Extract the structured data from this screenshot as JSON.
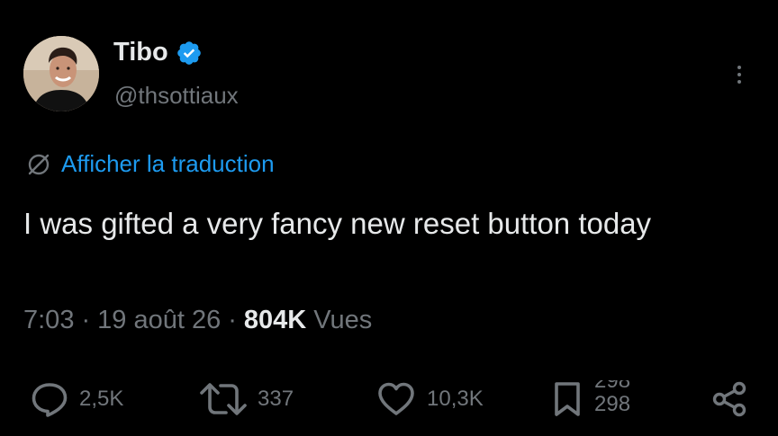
{
  "author": {
    "display_name": "Tibo",
    "handle": "@thsottiaux",
    "verified": true
  },
  "translate": {
    "label": "Afficher la traduction"
  },
  "tweet": {
    "text": "I was gifted a very fancy new reset button today"
  },
  "meta": {
    "time": "7:03",
    "separator": "·",
    "date": "19 août 26",
    "views_count": "804K",
    "views_label": "Vues"
  },
  "actions": {
    "replies": "2,5K",
    "reposts": "337",
    "likes": "10,3K",
    "bookmarks": "298"
  },
  "colors": {
    "background": "#000000",
    "primary_text": "#e7e9ea",
    "secondary_text": "#71767b",
    "accent": "#1d9bf0"
  },
  "icons": {
    "more": "more-vertical-icon",
    "verified": "verified-badge-icon",
    "translate": "translate-icon",
    "reply": "reply-icon",
    "repost": "repost-icon",
    "like": "heart-icon",
    "bookmark": "bookmark-icon",
    "share": "share-icon"
  }
}
